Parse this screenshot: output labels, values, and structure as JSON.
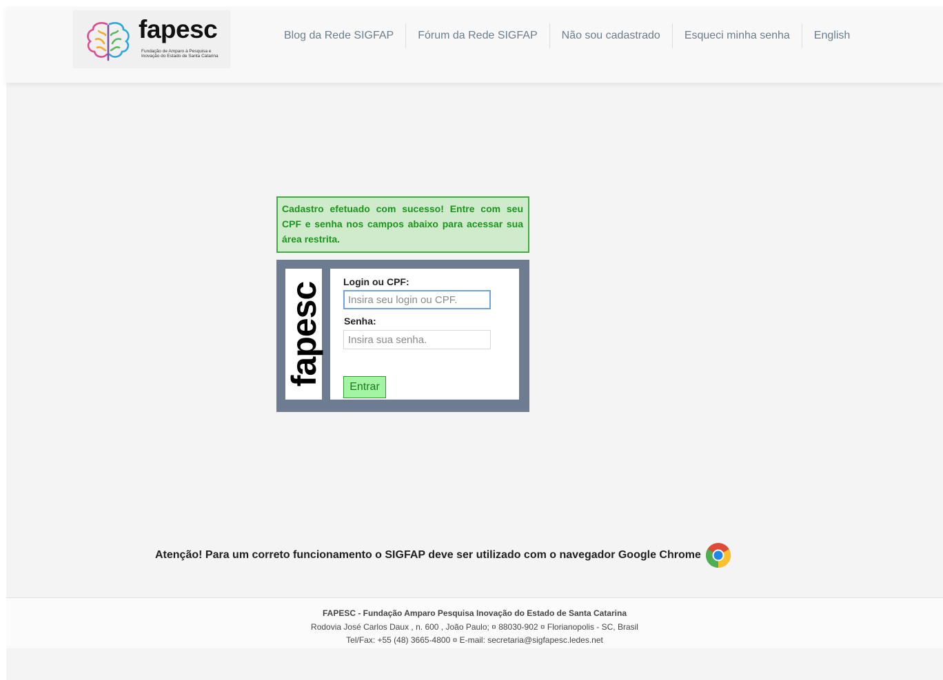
{
  "brand": {
    "name": "fapesc",
    "tagline": "Fundação de Amparo à Pesquisa e Inovação do Estado de Santa Catarina"
  },
  "nav": {
    "items": [
      {
        "label": "Blog da Rede SIGFAP"
      },
      {
        "label": "Fórum da Rede SIGFAP"
      },
      {
        "label": "Não sou cadastrado"
      },
      {
        "label": "Esqueci minha senha"
      },
      {
        "label": "English"
      }
    ]
  },
  "alert": {
    "message": "Cadastro efetuado com sucesso! Entre com seu CPF e senha nos campos abaixo para acessar sua área restrita."
  },
  "login": {
    "side_logo": "fapesc",
    "username_label": "Login ou CPF:",
    "username_placeholder": "Insira seu login ou CPF.",
    "username_value": "",
    "password_label": "Senha:",
    "password_placeholder": "Insira sua senha.",
    "password_value": "",
    "submit_label": "Entrar"
  },
  "warning": {
    "text": "Atenção! Para um correto funcionamento o SIGFAP deve ser utilizado com o navegador Google Chrome",
    "icon": "chrome-icon"
  },
  "footer": {
    "line1": "FAPESC - Fundação Amparo Pesquisa Inovação do Estado de Santa Catarina",
    "line2": "Rodovia José Carlos Daux , n. 600 , João Paulo; ¤ 88030-902 ¤ Florianopolis - SC, Brasil",
    "line3": "Tel/Fax: +55 (48) 3665-4800 ¤ E-mail: secretaria@sigfapesc.ledes.net"
  },
  "colors": {
    "alert_border": "#3fae42",
    "alert_bg": "#d0ebcb",
    "alert_text": "#1b941e",
    "login_frame": "#6e7c92",
    "button_bg": "#a3f5a3",
    "nav_text": "#6d7c8c"
  }
}
